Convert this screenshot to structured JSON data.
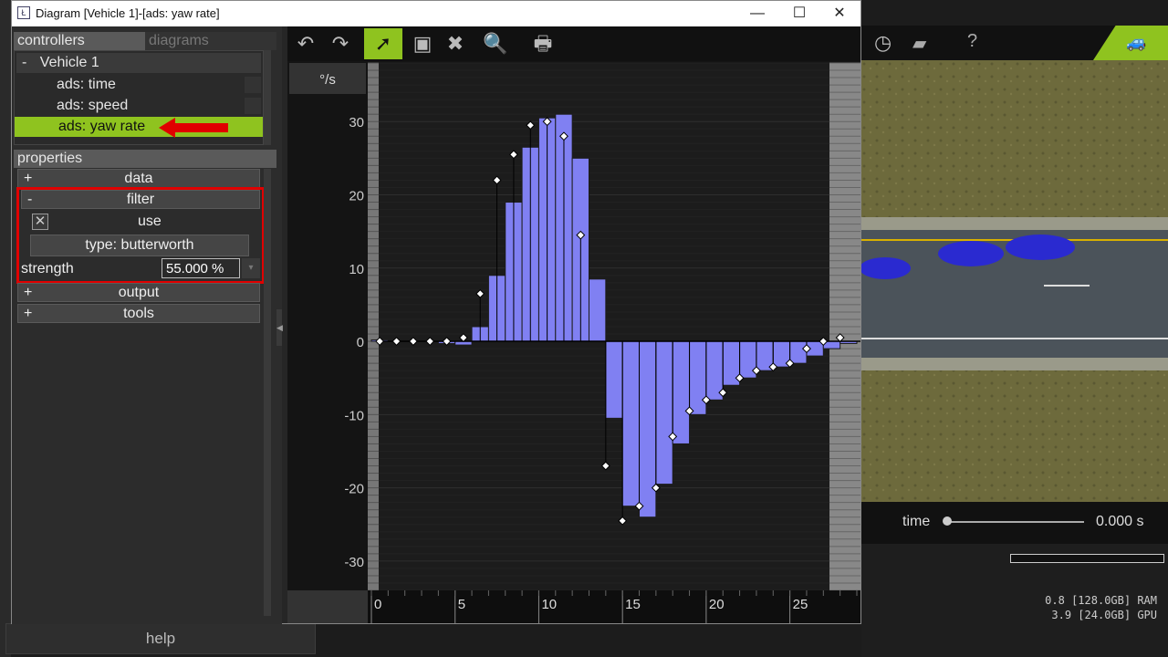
{
  "window": {
    "title": "Diagram [Vehicle 1]-[ads: yaw rate]",
    "controls": {
      "minimize": "—",
      "maximize": "☐",
      "close": "✕"
    }
  },
  "left_panel": {
    "tabs": [
      "controllers",
      "diagrams"
    ],
    "tree": {
      "root": {
        "sign": "-",
        "label": "Vehicle 1"
      },
      "items": [
        "ads: time",
        "ads: speed",
        "ads: yaw rate"
      ],
      "selected_index": 2
    },
    "properties": {
      "header": "properties",
      "sections": [
        {
          "sign": "+",
          "label": "data"
        },
        {
          "sign": "-",
          "label": "filter"
        },
        {
          "sign": "+",
          "label": "output"
        },
        {
          "sign": "+",
          "label": "tools"
        }
      ],
      "filter": {
        "use_label": "use",
        "use_checked": true,
        "type_label": "type: butterworth",
        "strength_label": "strength",
        "strength_value": "55.000 %"
      }
    },
    "help_label": "help"
  },
  "toolbar": {
    "icons": [
      "undo-icon",
      "redo-icon",
      "select-arrow-icon",
      "rectangle-select-icon",
      "delete-icon",
      "zoom-icon",
      "print-icon"
    ]
  },
  "chart_data": {
    "type": "bar",
    "unit_label": "°/s",
    "x_ticks": [
      "0",
      "5",
      "10",
      "15",
      "20",
      "25"
    ],
    "y_ticks": [
      "30",
      "20",
      "10",
      "0",
      "-10",
      "-20",
      "-30"
    ],
    "xlim": [
      0,
      29
    ],
    "ylim": [
      -34,
      38
    ],
    "bars": [
      {
        "x": 0,
        "value": 0.2
      },
      {
        "x": 1,
        "value": 0.1
      },
      {
        "x": 2,
        "value": 0.1
      },
      {
        "x": 3,
        "value": 0.1
      },
      {
        "x": 4,
        "value": -0.3
      },
      {
        "x": 5,
        "value": -0.5
      },
      {
        "x": 6,
        "value": 2.0
      },
      {
        "x": 7,
        "value": 9.0
      },
      {
        "x": 8,
        "value": 19.0
      },
      {
        "x": 9,
        "value": 26.5
      },
      {
        "x": 10,
        "value": 30.5
      },
      {
        "x": 11,
        "value": 31.0
      },
      {
        "x": 12,
        "value": 25.0
      },
      {
        "x": 13,
        "value": 8.5
      },
      {
        "x": 14,
        "value": -10.5
      },
      {
        "x": 15,
        "value": -22.5
      },
      {
        "x": 16,
        "value": -24.0
      },
      {
        "x": 17,
        "value": -19.5
      },
      {
        "x": 18,
        "value": -14.0
      },
      {
        "x": 19,
        "value": -10.0
      },
      {
        "x": 20,
        "value": -8.0
      },
      {
        "x": 21,
        "value": -6.0
      },
      {
        "x": 22,
        "value": -5.0
      },
      {
        "x": 23,
        "value": -4.0
      },
      {
        "x": 24,
        "value": -3.5
      },
      {
        "x": 25,
        "value": -3.0
      },
      {
        "x": 26,
        "value": -2.0
      },
      {
        "x": 27,
        "value": -1.0
      },
      {
        "x": 28,
        "value": -0.3
      }
    ],
    "points": [
      {
        "x": 0.5,
        "y": 0
      },
      {
        "x": 1.5,
        "y": 0
      },
      {
        "x": 2.5,
        "y": 0
      },
      {
        "x": 3.5,
        "y": 0
      },
      {
        "x": 4.5,
        "y": 0
      },
      {
        "x": 5.5,
        "y": 0.5
      },
      {
        "x": 6.5,
        "y": 6.5
      },
      {
        "x": 7.5,
        "y": 22
      },
      {
        "x": 8.5,
        "y": 25.5
      },
      {
        "x": 9.5,
        "y": 29.5
      },
      {
        "x": 10.5,
        "y": 30
      },
      {
        "x": 11.5,
        "y": 28
      },
      {
        "x": 12.5,
        "y": 14.5
      },
      {
        "x": 14.0,
        "y": -17
      },
      {
        "x": 15.0,
        "y": -24.5
      },
      {
        "x": 16.0,
        "y": -22.5
      },
      {
        "x": 17.0,
        "y": -20
      },
      {
        "x": 18.0,
        "y": -13
      },
      {
        "x": 19.0,
        "y": -9.5
      },
      {
        "x": 20.0,
        "y": -8
      },
      {
        "x": 21.0,
        "y": -7
      },
      {
        "x": 22.0,
        "y": -5
      },
      {
        "x": 23.0,
        "y": -4
      },
      {
        "x": 24.0,
        "y": -3.5
      },
      {
        "x": 25.0,
        "y": -3
      },
      {
        "x": 26.0,
        "y": -1
      },
      {
        "x": 27.0,
        "y": 0
      },
      {
        "x": 28.0,
        "y": 0.5
      }
    ],
    "bar_color": "#8080f2",
    "annotations": {
      "highlight_box_color": "#e00000",
      "arrow_color": "#e00000"
    }
  },
  "simulation": {
    "time_label": "time",
    "time_value": "0.000 s",
    "time_position": 0.0,
    "ram": "0.8 [128.0GB] RAM",
    "gpu": "3.9 [24.0GB] GPU"
  },
  "colors": {
    "selection_green": "#8fc31f",
    "bar_fill": "#8080f2",
    "chart_bg": "#1a1a1a",
    "car_blue": "#2a2ad0"
  }
}
